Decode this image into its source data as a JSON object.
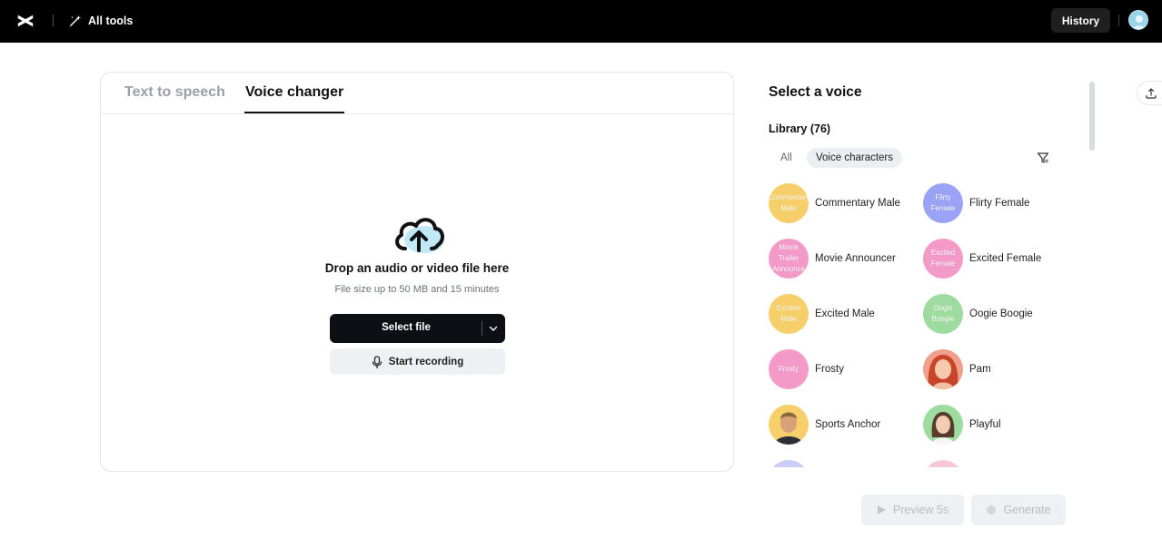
{
  "header": {
    "all_tools_label": "All tools",
    "history_label": "History"
  },
  "tabs": [
    {
      "label": "Text to speech",
      "active": false
    },
    {
      "label": "Voice changer",
      "active": true
    }
  ],
  "upload": {
    "title": "Drop an audio or video file here",
    "subtitle": "File size up to 50 MB and 15 minutes",
    "select_file_label": "Select file",
    "start_recording_label": "Start recording"
  },
  "voice_panel": {
    "title": "Select a voice",
    "library_label": "Library (76)",
    "filters": [
      "All",
      "Voice characters"
    ],
    "active_filter": "Voice characters",
    "voices": [
      {
        "name": "Commentary Male",
        "thumb_text": "Commentary Male",
        "color": "#f6cf6a"
      },
      {
        "name": "Flirty Female",
        "thumb_text": "Flirty Female",
        "color": "#9aa3f5"
      },
      {
        "name": "Movie Announcer",
        "thumb_text": "Movie Trailer Announce",
        "color": "#f49ac8"
      },
      {
        "name": "Excited Female",
        "thumb_text": "Excited Female",
        "color": "#f49ac8"
      },
      {
        "name": "Excited Male",
        "thumb_text": "Excited Male",
        "color": "#f6cf6a"
      },
      {
        "name": "Oogie Boogie",
        "thumb_text": "Oogie Boogie",
        "color": "#9edb9e"
      },
      {
        "name": "Frosty",
        "thumb_text": "Frosty",
        "color": "#f49ac8"
      },
      {
        "name": "Pam",
        "thumb_text": "",
        "color": "#f0a08a"
      },
      {
        "name": "Sports Anchor",
        "thumb_text": "",
        "color": "#f6cf6a"
      },
      {
        "name": "Playful",
        "thumb_text": "",
        "color": "#9edb9e"
      }
    ]
  },
  "actions": {
    "preview_label": "Preview 5s",
    "generate_label": "Generate"
  }
}
